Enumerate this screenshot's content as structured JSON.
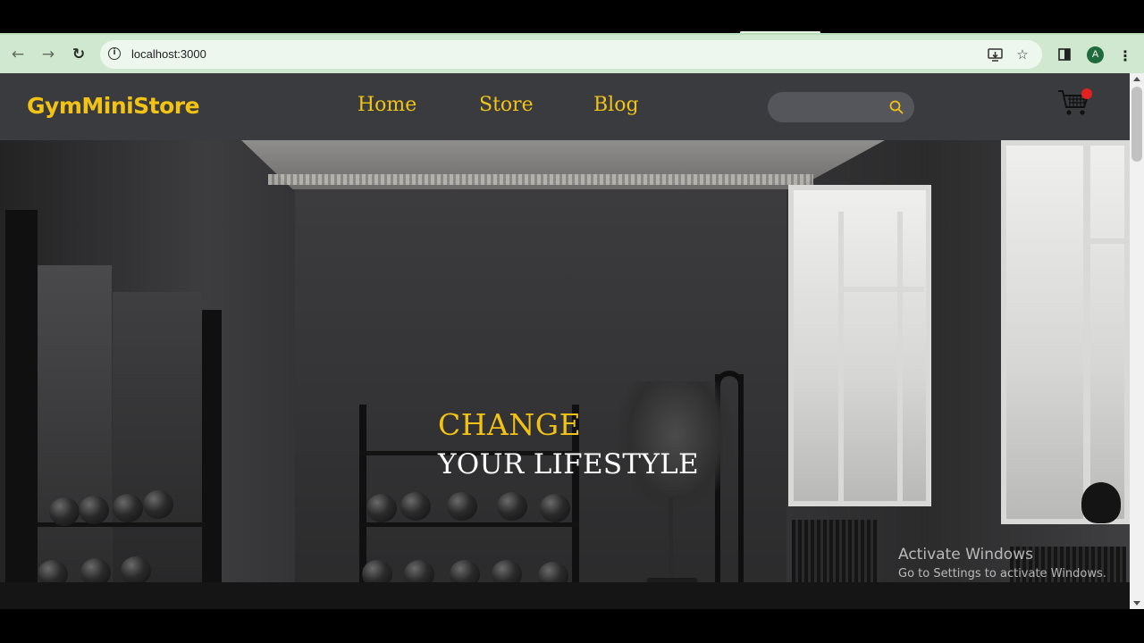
{
  "browser": {
    "url": "localhost:3000",
    "profile_initial": "A",
    "icons": {
      "back": "arrow-left-icon",
      "forward": "arrow-right-icon",
      "reload": "reload-icon",
      "site_info": "info-icon",
      "install": "install-app-icon",
      "bookmark": "star-icon",
      "side_panel": "side-panel-icon",
      "menu": "more-vert-icon"
    },
    "theme_color": "#cfe8cf"
  },
  "site": {
    "brand": "GymMiniStore",
    "nav": [
      {
        "label": "Home"
      },
      {
        "label": "Store"
      },
      {
        "label": "Blog"
      }
    ],
    "search": {
      "placeholder": "",
      "value": ""
    },
    "cart": {
      "icon": "cart-icon",
      "badge_color": "#e42121"
    },
    "colors": {
      "accent": "#f2c314",
      "header_bg": "#3a3b3f"
    }
  },
  "hero": {
    "headline_line1": "CHANGE",
    "headline_line2": "YOUR LIFESTYLE"
  },
  "watermark": {
    "title": "Activate Windows",
    "subtitle": "Go to Settings to activate Windows."
  }
}
